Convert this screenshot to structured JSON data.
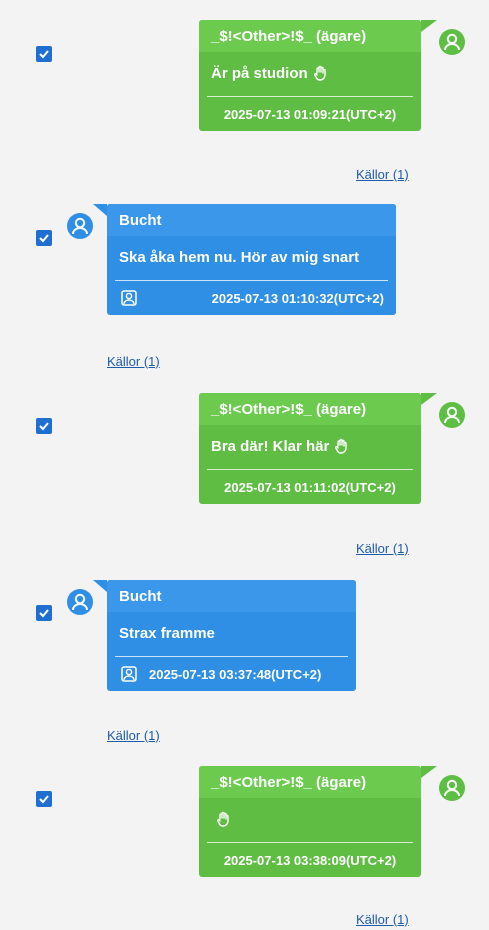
{
  "messages": [
    {
      "direction": "outgoing",
      "sender": "_$!<Other>!$_ (ägare)",
      "text": "Är på studion",
      "has_hand_icon": true,
      "timestamp": "2025-07-13 01:09:21(UTC+2)",
      "sources_label": "Källor (1)",
      "checked": true
    },
    {
      "direction": "incoming",
      "sender": "Bucht",
      "text": "Ska åka hem nu. Hör av mig snart",
      "has_hand_icon": false,
      "timestamp": "2025-07-13 01:10:32(UTC+2)",
      "sources_label": "Källor (1)",
      "checked": true
    },
    {
      "direction": "outgoing",
      "sender": "_$!<Other>!$_ (ägare)",
      "text": "Bra där! Klar här",
      "has_hand_icon": true,
      "timestamp": "2025-07-13 01:11:02(UTC+2)",
      "sources_label": "Källor (1)",
      "checked": true
    },
    {
      "direction": "incoming",
      "sender": "Bucht",
      "text": "Strax framme",
      "has_hand_icon": false,
      "timestamp": "2025-07-13 03:37:48(UTC+2)",
      "sources_label": "Källor (1)",
      "checked": true
    },
    {
      "direction": "outgoing",
      "sender": "_$!<Other>!$_ (ägare)",
      "text": "",
      "has_hand_icon": true,
      "timestamp": "2025-07-13 03:38:09(UTC+2)",
      "sources_label": "Källor (1)",
      "checked": true
    }
  ],
  "colors": {
    "outgoing": "#60bd43",
    "incoming": "#2e8fe4",
    "checkbox": "#1f6fd1",
    "link": "#1e5ba8"
  }
}
